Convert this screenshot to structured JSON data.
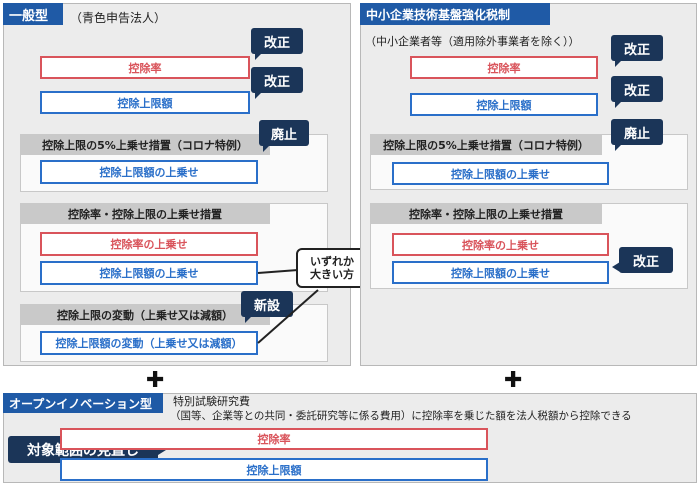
{
  "left": {
    "tag": "一般型",
    "subtitle": "（青色申告法人）",
    "rate_box": "控除率",
    "limit_box": "控除上限額",
    "bubble_rate": "改正",
    "bubble_limit": "改正",
    "corona": {
      "header": "控除上限の5%上乗せ措置（コロナ特例）",
      "box": "控除上限額の上乗せ",
      "bubble": "廃止"
    },
    "addon": {
      "header": "控除率・控除上限の上乗せ措置",
      "rate_box": "控除率の上乗せ",
      "limit_box": "控除上限額の上乗せ"
    },
    "variable": {
      "header": "控除上限の変動（上乗せ又は減額）",
      "box": "控除上限額の変動（上乗せ又は減額）",
      "bubble": "新設"
    }
  },
  "note": {
    "line1": "いずれか",
    "line2": "大きい方"
  },
  "right": {
    "tag": "中小企業技術基盤強化税制",
    "subtitle": "（中小企業者等（適用除外事業者を除く））",
    "rate_box": "控除率",
    "limit_box": "控除上限額",
    "bubble_rate": "改正",
    "bubble_limit": "改正",
    "corona": {
      "header": "控除上限の5%上乗せ措置（コロナ特例）",
      "box": "控除上限額の上乗せ",
      "bubble": "廃止"
    },
    "addon": {
      "header": "控除率・控除上限の上乗せ措置",
      "rate_box": "控除率の上乗せ",
      "limit_box": "控除上限額の上乗せ",
      "bubble": "改正"
    }
  },
  "plus_left": "✚",
  "plus_right": "✚",
  "open": {
    "tag": "オープンイノベーション型",
    "title": "特別試験研究費",
    "desc": "（国等、企業等との共同・委託研究等に係る費用）に控除率を乗じた額を法人税額から控除できる",
    "bubble": "対象範囲の見直し",
    "rate_box": "控除率",
    "limit_box": "控除上限額"
  }
}
